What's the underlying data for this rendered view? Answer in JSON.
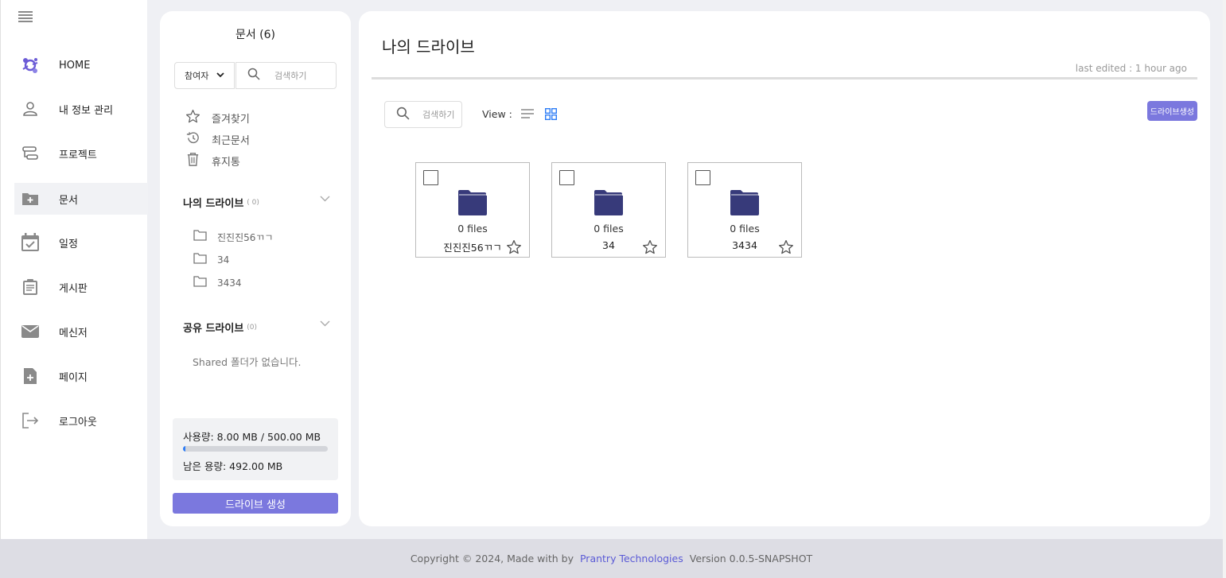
{
  "nav": {
    "items": [
      {
        "label": "HOME",
        "icon": "logo-icon"
      },
      {
        "label": "내 정보 관리",
        "icon": "user-icon"
      },
      {
        "label": "프로젝트",
        "icon": "project-icon"
      },
      {
        "label": "문서",
        "icon": "folder-plus-icon",
        "active": true
      },
      {
        "label": "일정",
        "icon": "calendar-check-icon"
      },
      {
        "label": "게시판",
        "icon": "clipboard-icon"
      },
      {
        "label": "메신저",
        "icon": "mail-icon"
      },
      {
        "label": "페이지",
        "icon": "file-plus-icon"
      },
      {
        "label": "로그아웃",
        "icon": "logout-icon"
      }
    ]
  },
  "docs": {
    "title": "문서 (6)",
    "filter_value": "참여자",
    "search_placeholder": "검색하기",
    "quick_links": [
      {
        "label": "즐겨찾기",
        "icon": "star-icon"
      },
      {
        "label": "최근문서",
        "icon": "history-icon"
      },
      {
        "label": "휴지통",
        "icon": "trash-icon"
      }
    ],
    "my_drive": {
      "title": "나의 드라이브",
      "count": "( 0)",
      "folders": [
        "진진진56ㄲㄱ",
        "34",
        "3434"
      ]
    },
    "shared_drive": {
      "title": "공유 드라이브",
      "count": "(0)",
      "empty_text": "Shared 폴더가 없습니다."
    },
    "usage": {
      "used_text": "사용량: 8.00 MB / 500.00 MB",
      "remaining_text": "남은 용량: 492.00 MB",
      "fraction": 0.016
    },
    "create_button": "드라이브 생성"
  },
  "main": {
    "title": "나의 드라이브",
    "last_edited": "last edited : 1 hour ago",
    "search_placeholder": "검색하기",
    "view_label": "View :",
    "create_button": "드라이브생성",
    "cards": [
      {
        "files": "0 files",
        "name": "진진진56ㄲㄱ"
      },
      {
        "files": "0 files",
        "name": "34"
      },
      {
        "files": "0 files",
        "name": "3434"
      }
    ]
  },
  "footer": {
    "copyright": "Copyright © 2024, Made with  by",
    "brand": "Prantry Technologies",
    "version": "Version 0.0.5-SNAPSHOT"
  },
  "colors": {
    "accent": "#7b78de",
    "folder": "#373a7a",
    "progress": "#2e7df6"
  }
}
